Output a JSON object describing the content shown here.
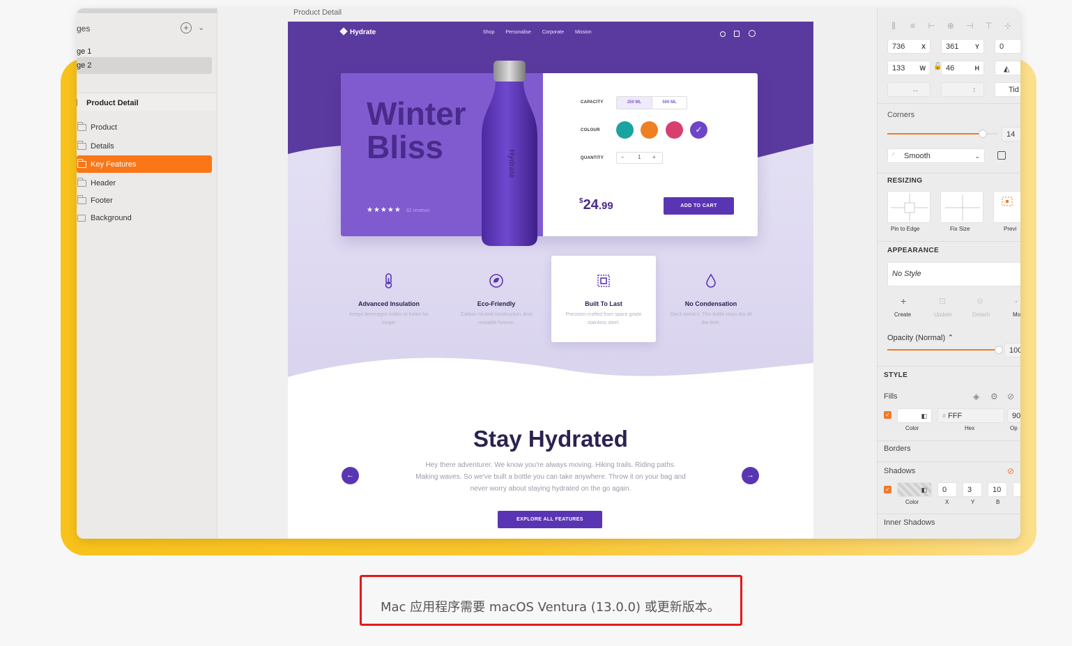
{
  "sidebar": {
    "pages_label": "ges",
    "pages": [
      "ge 1",
      "ge 2"
    ],
    "artboard": "Product Detail",
    "layers": [
      "Product",
      "Details",
      "Key Features",
      "Header",
      "Footer",
      "Background"
    ]
  },
  "canvas": {
    "artboard_title": "Product Detail",
    "brand": "Hydrate",
    "nav_links": [
      "Shop",
      "Personalise",
      "Corporate",
      "Mission"
    ],
    "hero_title_1": "Winter",
    "hero_title_2": "Bliss",
    "stars": "★★★★★",
    "reviews": "82 reviews",
    "bottle_brand": "Hydrate",
    "capacity_label": "CAPACITY",
    "capacity_options": [
      "250 ML",
      "500 ML"
    ],
    "colour_label": "COLOUR",
    "colours": [
      "#1aa3a0",
      "#ef7f23",
      "#d7406e",
      "#6e45c6"
    ],
    "quantity_label": "QUANTITY",
    "quantity_minus": "−",
    "quantity_value": "1",
    "quantity_plus": "+",
    "price_currency": "$",
    "price_whole": "24",
    "price_cents": ".99",
    "add_to_cart": "ADD TO CART",
    "features": [
      {
        "title": "Advanced Insulation",
        "desc": "Keeps beverages colder or hotter for longer"
      },
      {
        "title": "Eco-Friendly",
        "desc": "Carbon neutral construction. And reusable forever."
      },
      {
        "title": "Built To Last",
        "desc": "Precision-crafted from space grade stainless steel."
      },
      {
        "title": "No Condensation",
        "desc": "Don't sweat it. This bottle stays dry all the time."
      }
    ],
    "section_title": "Stay Hydrated",
    "section_body": "Hey there adventurer. We know you're always moving. Hiking trails. Riding paths. Making waves. So we've built a bottle you can take anywhere. Throw it on your bag and never worry about staying hydrated on the go again.",
    "prev_arrow": "←",
    "next_arrow": "→",
    "explore_button": "EXPLORE ALL FEATURES"
  },
  "inspector": {
    "x": "736",
    "x_unit": "X",
    "y": "361",
    "y_unit": "Y",
    "rotation": "0",
    "w": "133",
    "w_unit": "W",
    "h": "46",
    "h_unit": "H",
    "tidy": "Tid",
    "corners_label": "Corners",
    "corners_value": "14",
    "corners_level": 0.87,
    "corner_style": "Smooth",
    "resizing_label": "RESIZING",
    "pin_to_edge": "Pin to Edge",
    "fix_size": "Fix Size",
    "preview": "Previ",
    "appearance_label": "APPEARANCE",
    "style_value": "No Style",
    "create": "Create",
    "update": "Update",
    "detach": "Detach",
    "more": "Mo",
    "opacity_label": "Opacity (Normal)",
    "opacity_value": "100",
    "opacity_level": 1.0,
    "style_label": "STYLE",
    "fills_label": "Fills",
    "hex_value": "FFF",
    "fill_opacity": "90",
    "color_label": "Color",
    "hex_label": "Hex",
    "op_label": "Op",
    "borders_label": "Borders",
    "shadows_label": "Shadows",
    "shadow_x": "0",
    "shadow_y": "3",
    "shadow_b": "10",
    "x_label": "X",
    "y_label": "Y",
    "b_label": "B",
    "inner_shadows_label": "Inner Shadows"
  },
  "notice": "Mac 应用程序需要 macOS Ventura (13.0.0) 或更新版本。",
  "colors": {
    "accent": "#fa7617",
    "brand_purple": "#5a35b3",
    "hero_purple": "#7f5bcf",
    "glow": "#f8c21a",
    "notice_border": "#e4181a"
  }
}
